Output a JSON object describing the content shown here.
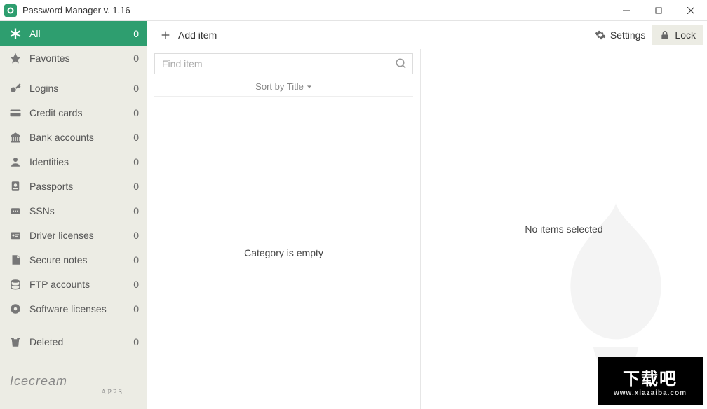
{
  "titlebar": {
    "title": "Password Manager v. 1.16"
  },
  "sidebar": {
    "items": [
      {
        "label": "All",
        "count": "0",
        "icon": "asterisk",
        "active": true
      },
      {
        "label": "Favorites",
        "count": "0",
        "icon": "star"
      },
      {
        "label": "Logins",
        "count": "0",
        "icon": "key"
      },
      {
        "label": "Credit cards",
        "count": "0",
        "icon": "card"
      },
      {
        "label": "Bank accounts",
        "count": "0",
        "icon": "bank"
      },
      {
        "label": "Identities",
        "count": "0",
        "icon": "person"
      },
      {
        "label": "Passports",
        "count": "0",
        "icon": "passport"
      },
      {
        "label": "SSNs",
        "count": "0",
        "icon": "ssn"
      },
      {
        "label": "Driver licenses",
        "count": "0",
        "icon": "license"
      },
      {
        "label": "Secure notes",
        "count": "0",
        "icon": "note"
      },
      {
        "label": "FTP accounts",
        "count": "0",
        "icon": "ftp"
      },
      {
        "label": "Software licenses",
        "count": "0",
        "icon": "software"
      },
      {
        "label": "Deleted",
        "count": "0",
        "icon": "trash"
      }
    ],
    "brand": {
      "line1": "Icecream",
      "line2": "APPS"
    }
  },
  "toolbar": {
    "add_label": "Add item",
    "settings_label": "Settings",
    "lock_label": "Lock"
  },
  "list": {
    "search_placeholder": "Find item",
    "sort_label": "Sort by Title",
    "empty_message": "Category is empty"
  },
  "detail": {
    "empty_message": "No items selected"
  },
  "badge": {
    "big": "下载吧",
    "small": "www.xiazaiba.com"
  }
}
